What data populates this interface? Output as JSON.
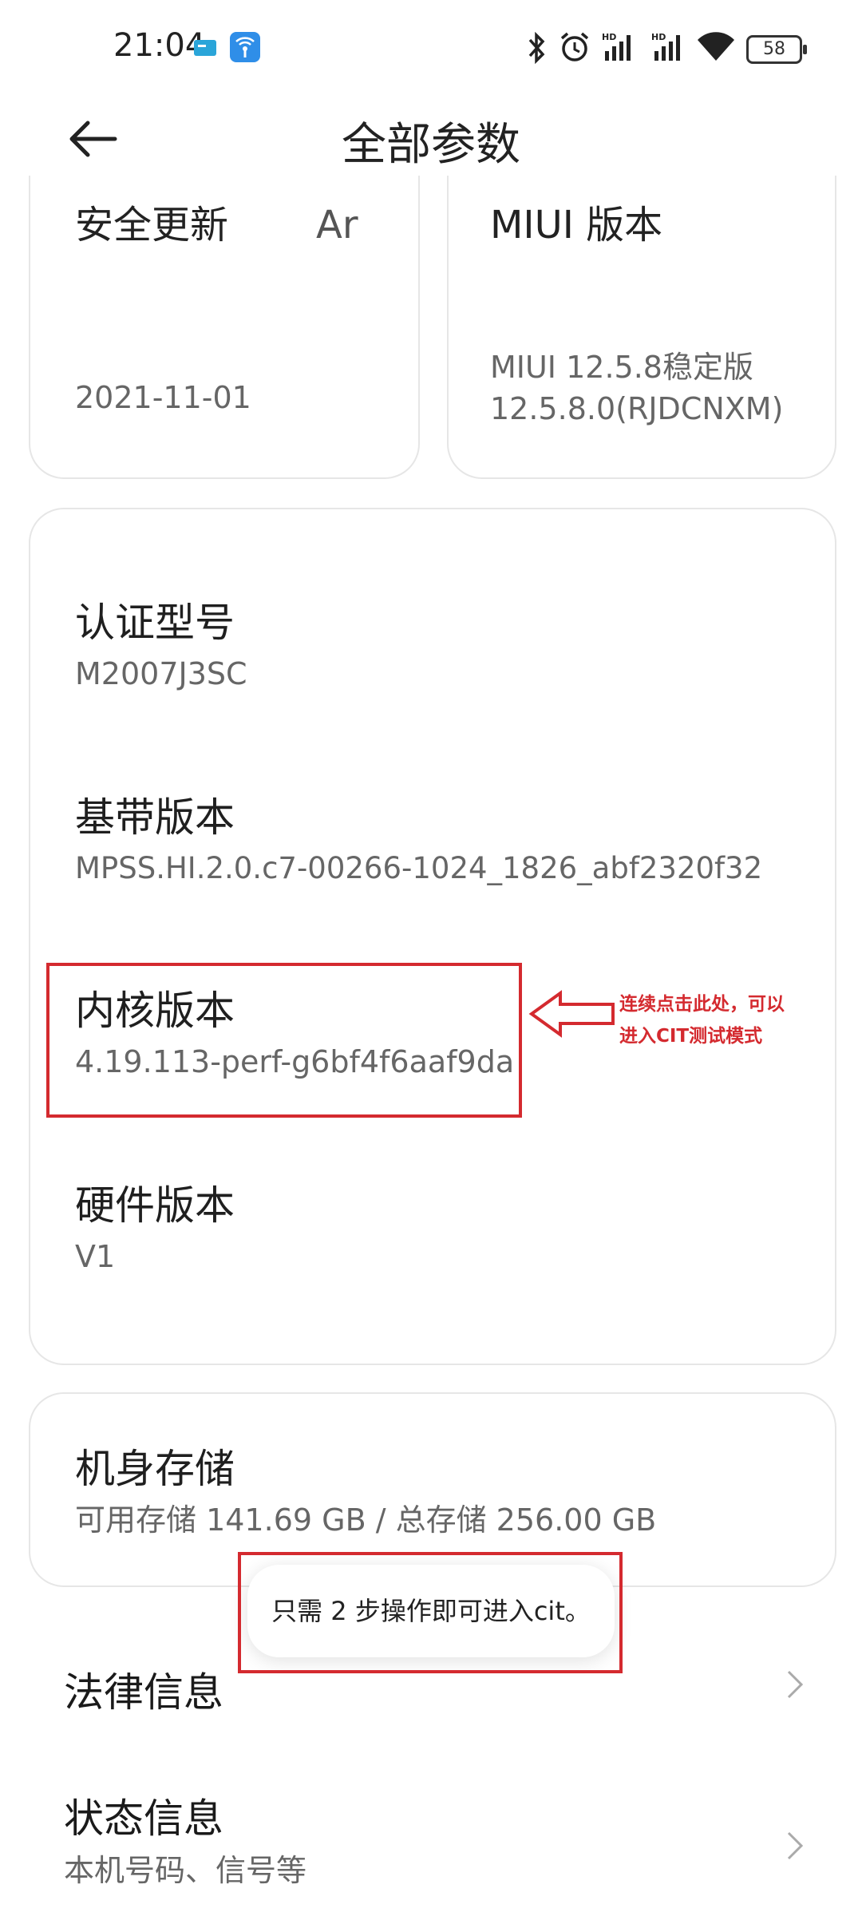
{
  "status_bar": {
    "time": "21:04",
    "battery": "58",
    "icons": [
      "sim-card-icon",
      "wifi-hotspot-app-icon",
      "bluetooth-icon",
      "alarm-icon",
      "hd-signal-icon",
      "hd-signal-icon",
      "wifi-icon",
      "battery-icon"
    ]
  },
  "header": {
    "title": "全部参数",
    "back_icon": "back-arrow-icon"
  },
  "tiles": [
    {
      "title": "安全更新",
      "title_overflow": "Ar",
      "value": "2021-11-01"
    },
    {
      "title": "MIUI 版本",
      "value_line1": "MIUI 12.5.8稳定版",
      "value_line2": "12.5.8.0(RJDCNXM)"
    }
  ],
  "details": [
    {
      "label": "认证型号",
      "value": "M2007J3SC"
    },
    {
      "label": "基带版本",
      "value": "MPSS.HI.2.0.c7-00266-1024_1826_abf2320f32"
    },
    {
      "label": "内核版本",
      "value": "4.19.113-perf-g6bf4f6aaf9da"
    },
    {
      "label": "硬件版本",
      "value": "V1"
    }
  ],
  "annotation": {
    "line1": "连续点击此处，可以",
    "line2": "进入CIT测试模式",
    "color": "#d42a2f"
  },
  "storage": {
    "label": "机身存储",
    "value": "可用存储 141.69 GB / 总存储 256.00 GB"
  },
  "toast": {
    "text": "只需 2 步操作即可进入cit。"
  },
  "links": [
    {
      "title": "法律信息"
    },
    {
      "title": "状态信息",
      "subtitle": "本机号码、信号等"
    }
  ]
}
